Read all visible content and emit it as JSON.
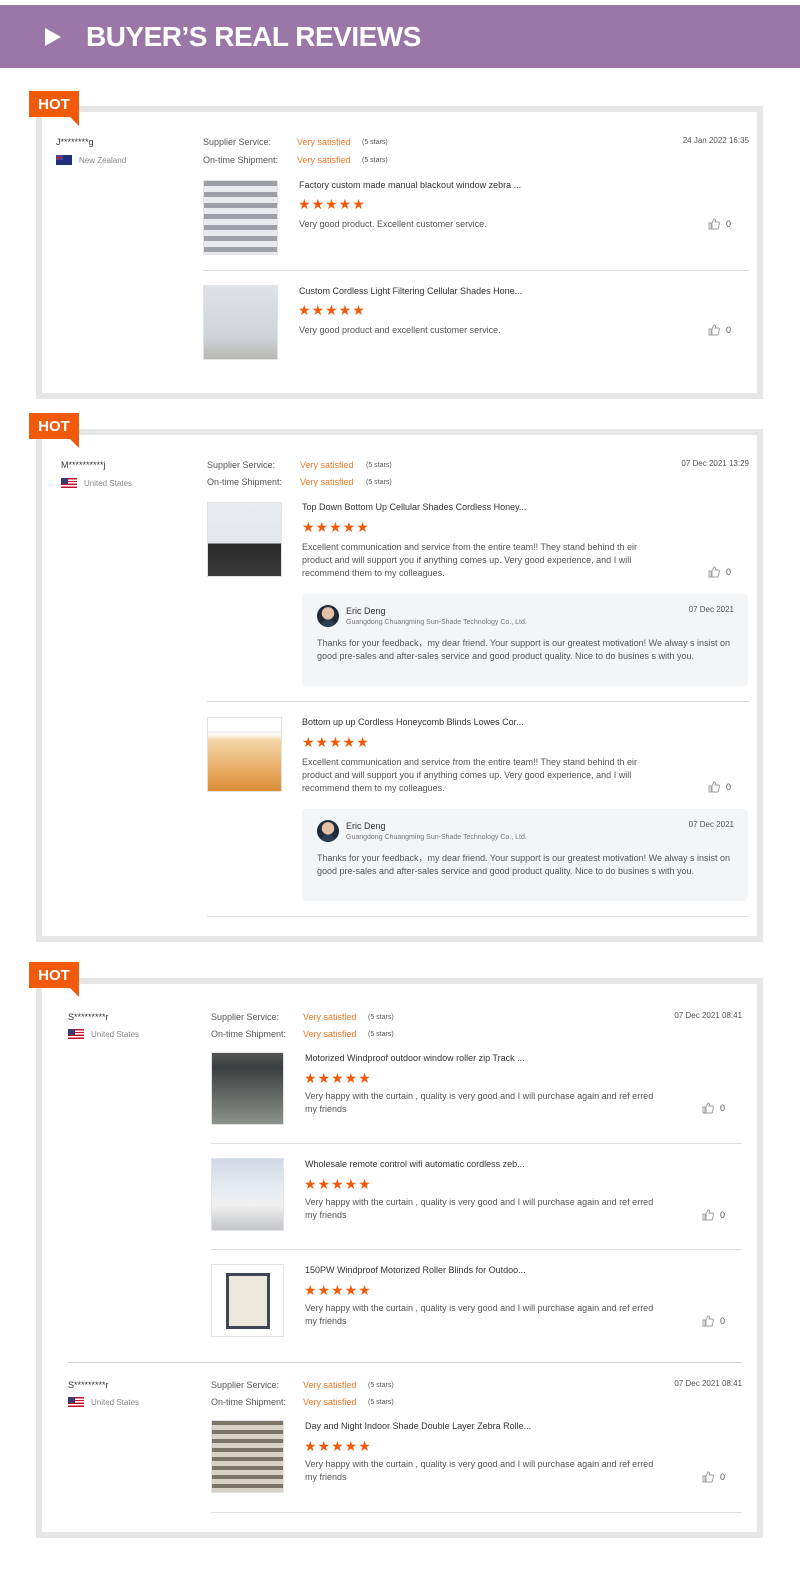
{
  "header": {
    "title": "BUYER’S REAL REVIEWS"
  },
  "hot_label": "HOT",
  "labels": {
    "supplier_service": "Supplier Service:",
    "ontime_shipment": "On-time Shipment:",
    "very_satisfied": "Very satisfied",
    "five_stars": "(5 stars)"
  },
  "stars": "★★★★★",
  "reviews": [
    {
      "user": "J********g",
      "country": "New Zealand",
      "date": "24 Jan 2022 16:35",
      "items": [
        {
          "title": "Factory custom made manual blackout window zebra ...",
          "text": "Very good product. Excellent customer service.",
          "likes": "0"
        },
        {
          "title": "Custom Cordless Light Filtering Cellular Shades Hone...",
          "text": "Very good product and excellent customer service.",
          "likes": "0"
        }
      ]
    },
    {
      "user": "M**********j",
      "country": "United States",
      "date": "07 Dec 2021 13:29",
      "items": [
        {
          "title": "Top Down Bottom Up Cellular Shades Cordless Honey...",
          "text": "Excellent communication and service from the entire team!! They stand behind th eir product and will support you if anything comes up.  Very good experience, and I will recommend them to my colleagues.",
          "likes": "0",
          "reply": {
            "name": "Eric Deng",
            "company": "Guangdong Chuangming Sun-Shade Technology Co., Ltd.",
            "date": "07 Dec 2021",
            "text": "Thanks for your feedback，my dear friend. Your support is our greatest motivation! We alway s insist on good pre-sales and after-sales service and good product quality. Nice to do busines s with you."
          }
        },
        {
          "title": "Bottom up up Cordless Honeycomb Blinds Lowes Cor...",
          "text": "Excellent communication and service from the entire team!! They stand behind th eir product and will support you if anything comes up.  Very good experience, and I will recommend them to my colleagues.",
          "likes": "0",
          "reply": {
            "name": "Eric Deng",
            "company": "Guangdong Chuangming Sun-Shade Technology Co., Ltd.",
            "date": "07 Dec 2021",
            "text": "Thanks for your feedback，my dear friend. Your support is our greatest motivation! We alway s insist on good pre-sales and after-sales service and good product quality. Nice to do busines s with you."
          }
        }
      ]
    },
    {
      "user": "S*********r",
      "country": "United States",
      "date": "07 Dec 2021 08:41",
      "items": [
        {
          "title": "Motorized Windproof outdoor window roller zip Track ...",
          "text": "Very happy with the curtain , quality is very good and I will purchase again and ref erred my friends",
          "likes": "0"
        },
        {
          "title": "Wholesale remote control wifi automatic cordless zeb...",
          "text": "Very happy with the curtain , quality is very good and I will purchase again and ref erred my friends",
          "likes": "0"
        },
        {
          "title": "150PW Windproof Motorized Roller Blinds for Outdoo...",
          "text": "Very happy with the curtain , quality is very good and I will purchase again and ref erred my friends",
          "likes": "0"
        }
      ]
    },
    {
      "user": "S*********r",
      "country": "United States",
      "date": "07 Dec 2021 08:41",
      "items": [
        {
          "title": "Day and Night Indoor Shade Double Layer Zebra Rolle...",
          "text": "Very happy with the curtain , quality is very good and I will purchase again and ref erred my friends",
          "likes": "0"
        }
      ]
    }
  ],
  "colors": {
    "header": "#9a77a6",
    "hot": "#f05a0a",
    "stars": "#f05a0a",
    "satisfied": "#f07a2a"
  },
  "icons": {
    "play": "play-triangle-icon",
    "like": "thumbs-up-icon",
    "flag_nz": "new-zealand-flag-icon",
    "flag_us": "us-flag-icon"
  }
}
